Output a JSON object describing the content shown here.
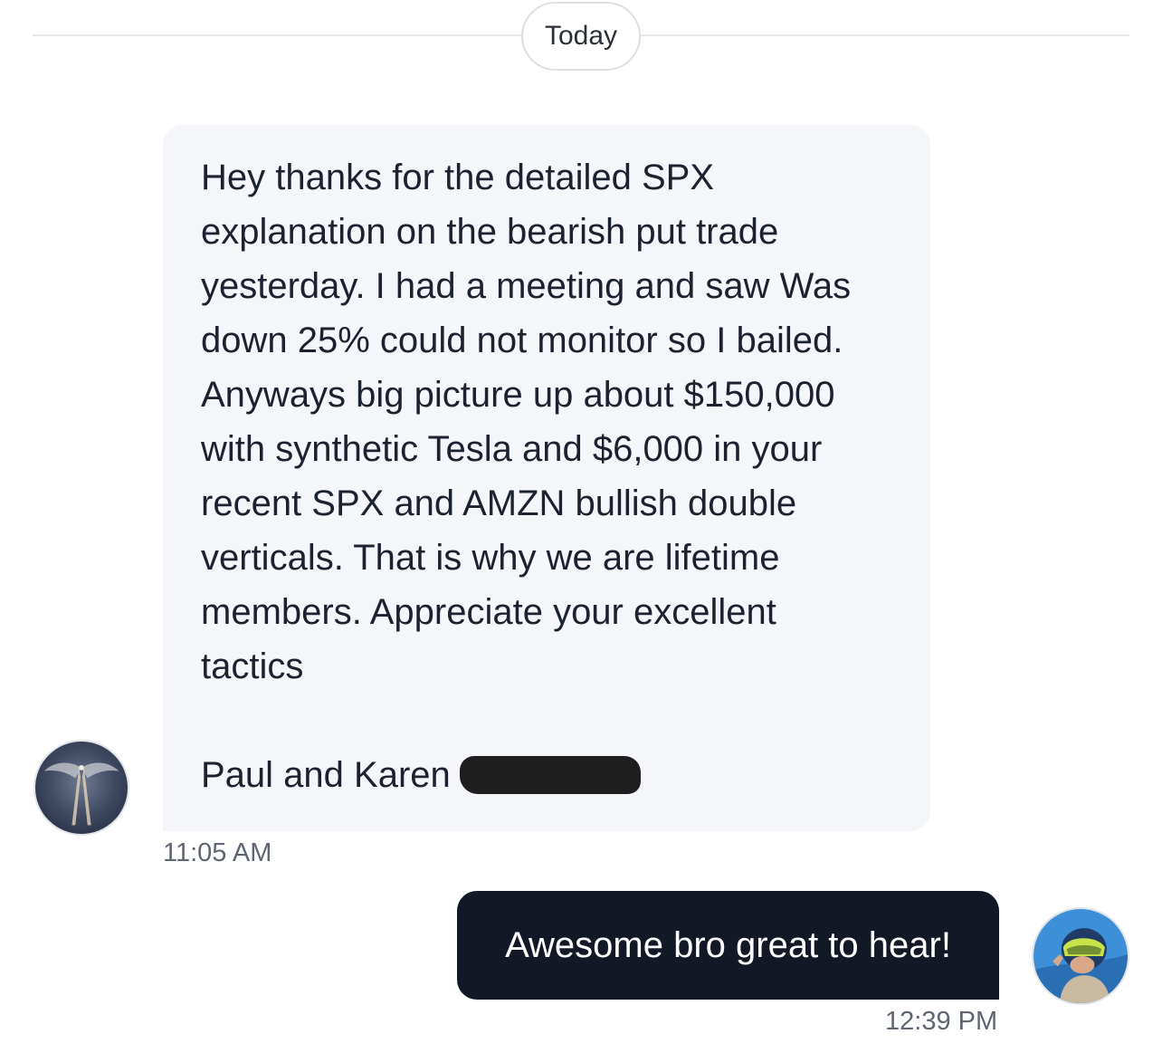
{
  "divider": {
    "label": "Today"
  },
  "incoming_message": {
    "text": "Hey thanks for the detailed SPX\nexplanation on the bearish put trade\nyesterday. I had a meeting and saw Was\ndown 25% could not monitor so I bailed.\nAnyways big picture up about $150,000\nwith synthetic Tesla and $6,000 in your\nrecent SPX and AMZN bullish double\nverticals. That is why we are lifetime\nmembers. Appreciate your excellent\ntactics\n\nPaul and Karen",
    "timestamp": "11:05 AM",
    "avatar_icon": "angel-wings-avatar-icon"
  },
  "outgoing_message": {
    "text": "Awesome bro great to hear!",
    "timestamp": "12:39 PM",
    "avatar_icon": "pilot-avatar-icon"
  },
  "colors": {
    "incoming_bubble": "#f4f6fa",
    "outgoing_bubble": "#121826",
    "timestamp": "#5f6673",
    "redaction": "#1e1e1e"
  }
}
